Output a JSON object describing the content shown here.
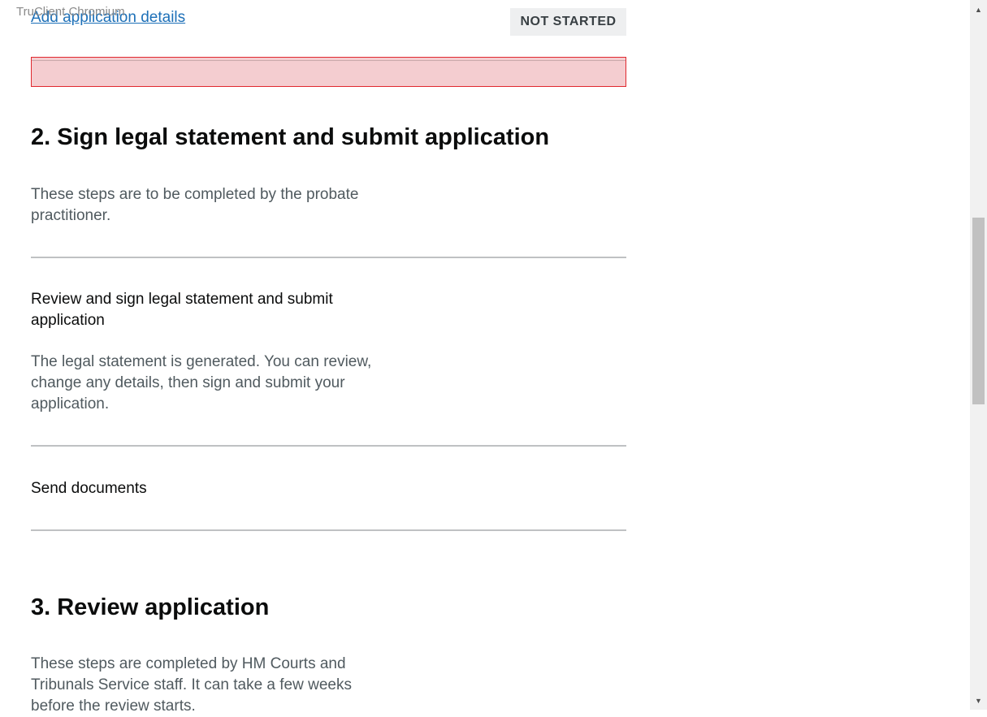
{
  "browser": {
    "watermark": "TruClient Chromium"
  },
  "section1": {
    "task_link": "Add application details",
    "status": "NOT STARTED"
  },
  "section2": {
    "title": "2. Sign legal statement and submit application",
    "hint": "These steps are to be completed by the probate practitioner.",
    "tasks": [
      {
        "name": "Review and sign legal statement and submit application",
        "hint": "The legal statement is generated. You can review, change any details, then sign and submit your application."
      },
      {
        "name": "Send documents"
      }
    ]
  },
  "section3": {
    "title": "3. Review application",
    "hint": "These steps are completed by HM Courts and Tribunals Service staff. It can take a few weeks before the review starts."
  },
  "icons": {
    "scroll_up": "triangle-up-icon",
    "scroll_down": "triangle-down-icon"
  },
  "colors": {
    "link": "#1d70b8",
    "error": "#e0282e",
    "text": "#0b0c0c",
    "secondary": "#505a5f"
  }
}
